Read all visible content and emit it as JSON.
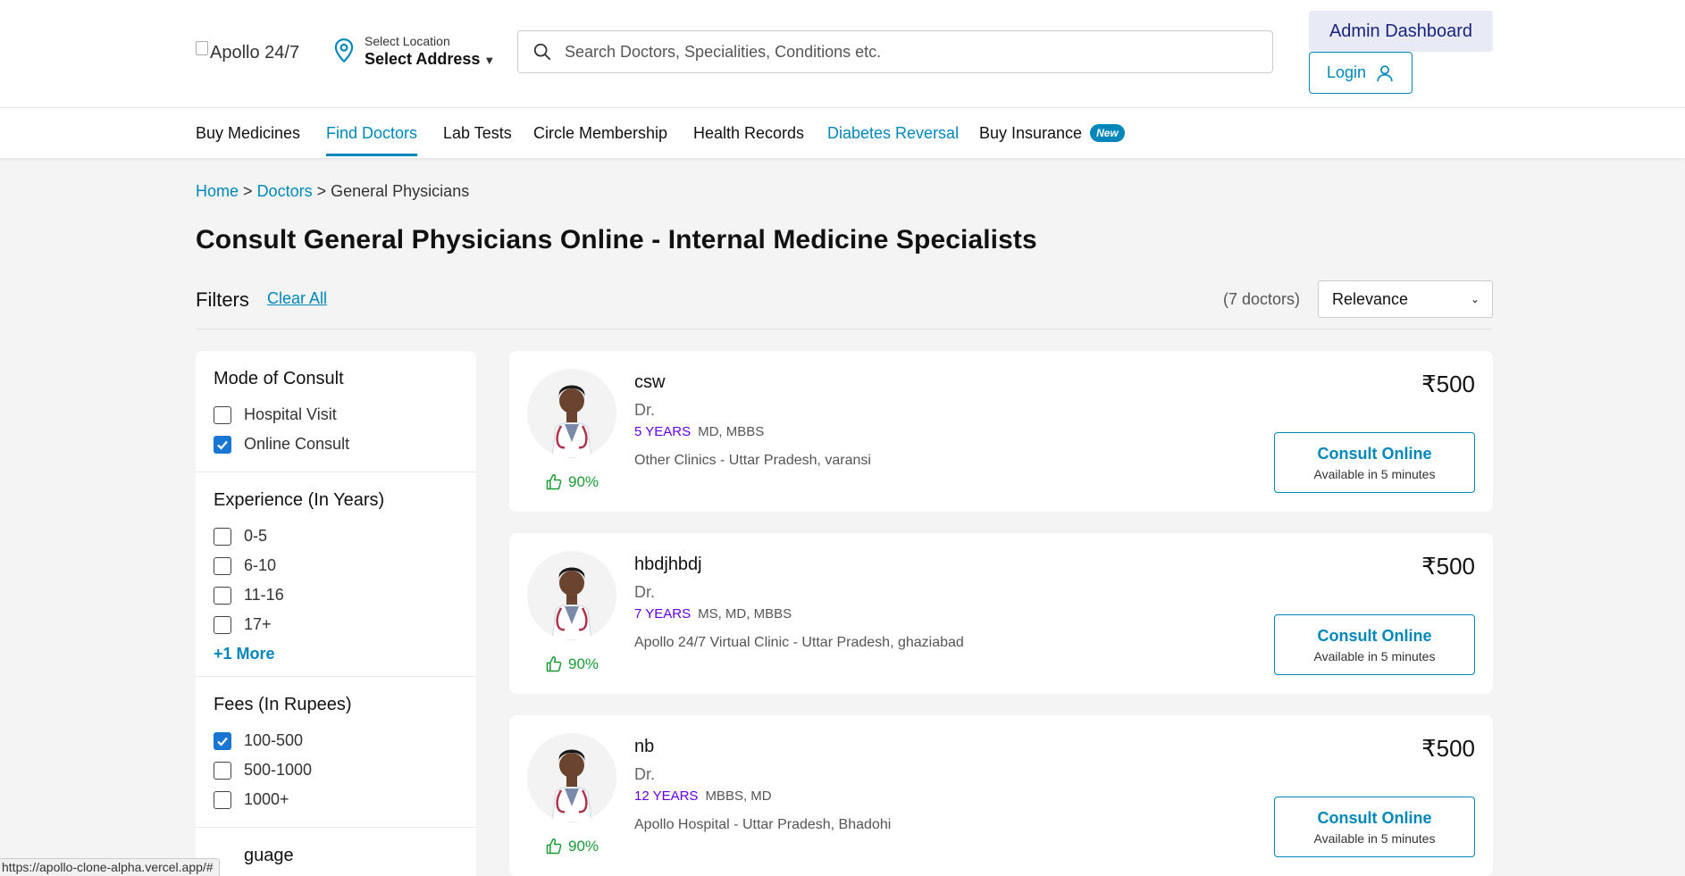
{
  "header": {
    "logo_alt": "Apollo 24/7",
    "location_label": "Select Location",
    "location_value": "Select Address",
    "search_placeholder": "Search Doctors, Specialities, Conditions etc.",
    "admin_label": "Admin Dashboard",
    "login_label": "Login"
  },
  "nav": {
    "items": [
      {
        "label": "Buy Medicines"
      },
      {
        "label": "Find Doctors"
      },
      {
        "label": "Lab Tests"
      },
      {
        "label": "Circle Membership"
      },
      {
        "label": "Health Records"
      },
      {
        "label": "Diabetes Reversal"
      },
      {
        "label": "Buy Insurance"
      }
    ],
    "new_badge": "New"
  },
  "breadcrumb": {
    "home": "Home",
    "sep1": ">",
    "doctors": "Doctors",
    "sep2": ">",
    "current": "General Physicians"
  },
  "page_title": "Consult General Physicians Online - Internal Medicine Specialists",
  "filters": {
    "label": "Filters",
    "clear_all": "Clear All",
    "count": "(7 doctors)",
    "sort_value": "Relevance",
    "sections": [
      {
        "title": "Mode of Consult",
        "options": [
          {
            "label": "Hospital Visit",
            "checked": false
          },
          {
            "label": "Online Consult",
            "checked": true
          }
        ]
      },
      {
        "title": "Experience (In Years)",
        "options": [
          {
            "label": "0-5",
            "checked": false
          },
          {
            "label": "6-10",
            "checked": false
          },
          {
            "label": "11-16",
            "checked": false
          },
          {
            "label": "17+",
            "checked": false
          }
        ],
        "more": "+1 More"
      },
      {
        "title": "Fees (In Rupees)",
        "options": [
          {
            "label": "100-500",
            "checked": true
          },
          {
            "label": "500-1000",
            "checked": false
          },
          {
            "label": "1000+",
            "checked": false
          }
        ]
      }
    ],
    "next_section_partial": "guage"
  },
  "doctors": [
    {
      "name": "csw",
      "title": "Dr.",
      "experience": "5 YEARS",
      "degrees": "MD,  MBBS",
      "clinic": "Other Clinics - Uttar Pradesh, varansi",
      "rating": "90%",
      "fee": "₹500",
      "consult_label": "Consult Online",
      "availability": "Available in 5 minutes"
    },
    {
      "name": "hbdjhbdj",
      "title": "Dr.",
      "experience": "7 YEARS",
      "degrees": "MS,  MD,  MBBS",
      "clinic": "Apollo 24/7 Virtual Clinic - Uttar Pradesh, ghaziabad",
      "rating": "90%",
      "fee": "₹500",
      "consult_label": "Consult Online",
      "availability": "Available in 5 minutes"
    },
    {
      "name": "nb",
      "title": "Dr.",
      "experience": "12 YEARS",
      "degrees": "MBBS,  MD",
      "clinic": "Apollo Hospital - Uttar Pradesh, Bhadohi",
      "rating": "90%",
      "fee": "₹500",
      "consult_label": "Consult Online",
      "availability": "Available in 5 minutes"
    }
  ],
  "status_bar": {
    "url": "https://apollo-clone-alpha.vercel.app/#"
  },
  "colors": {
    "accent": "#0087ba",
    "experience": "#6200ea",
    "rating": "#1a9c35",
    "admin_bg": "#e8eaf6"
  }
}
